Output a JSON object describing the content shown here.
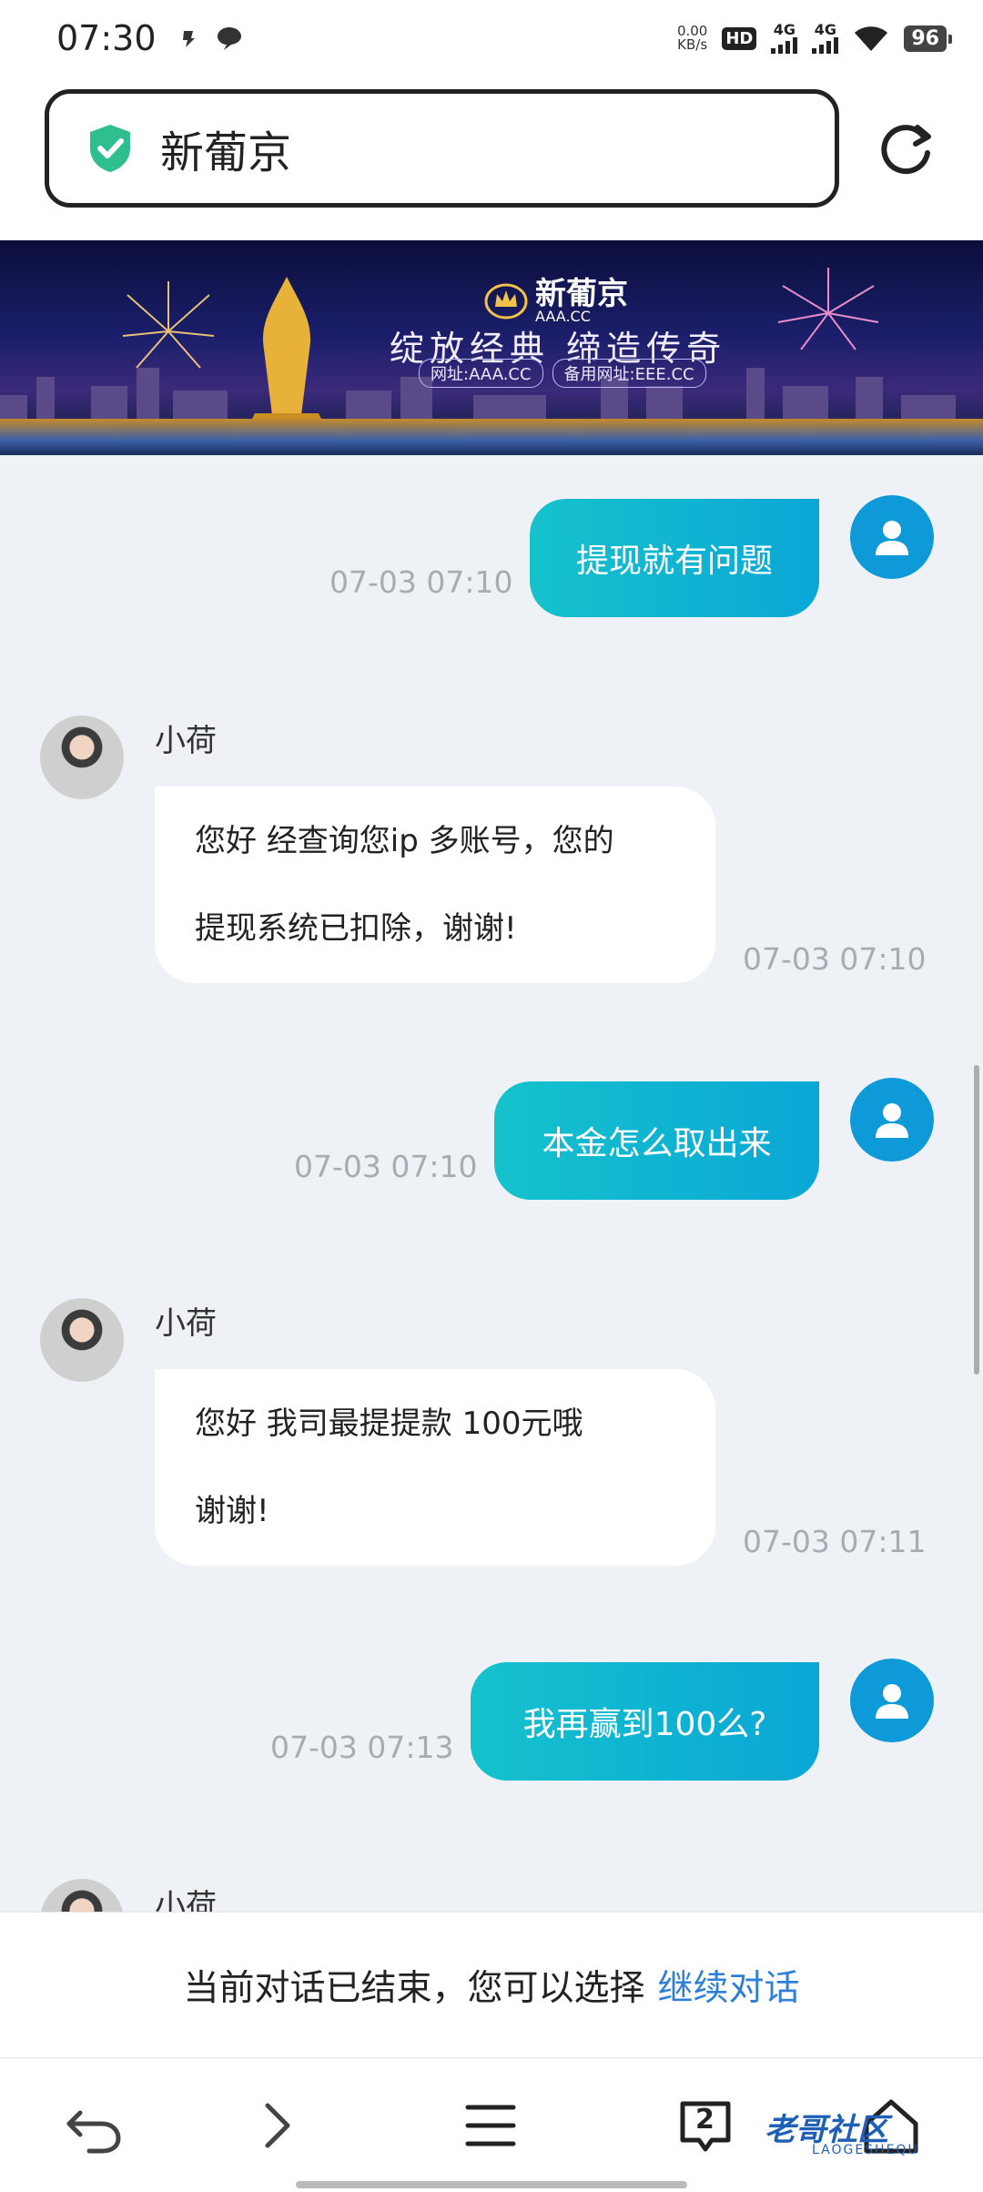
{
  "status_bar": {
    "time": "07:30",
    "net_speed_value": "0.00",
    "net_speed_unit": "KB/s",
    "hd_label": "HD",
    "sim1_label": "4G",
    "sim2_label": "4G",
    "battery": "96",
    "icons": [
      "notification-icon",
      "chat-bubble-icon",
      "wifi-icon"
    ]
  },
  "address_bar": {
    "title": "新葡京",
    "shield_color": "#2fbf8f"
  },
  "banner": {
    "brand": "新葡京",
    "brand_sub": "AAA.CC",
    "slogan": "绽放经典  缔造传奇",
    "url_main": "网址:AAA.CC",
    "url_backup": "备用网址:EEE.CC"
  },
  "messages": [
    {
      "side": "out",
      "text": "提现就有问题",
      "time": "07-03 07:10"
    },
    {
      "side": "in",
      "name": "小荷",
      "lines": [
        "您好 经查询您ip 多账号，您的",
        "提现系统已扣除，谢谢!"
      ],
      "time": "07-03 07:10"
    },
    {
      "side": "out",
      "text": "本金怎么取出来",
      "time": "07-03 07:10"
    },
    {
      "side": "in",
      "name": "小荷",
      "lines": [
        "您好  我司最提提款  100元哦",
        "谢谢!"
      ],
      "time": "07-03 07:11"
    },
    {
      "side": "out",
      "text": "我再赢到100么?",
      "time": "07-03 07:13"
    },
    {
      "side": "in",
      "name": "小荷"
    }
  ],
  "ended_bar": {
    "text": "当前对话已结束，您可以选择",
    "link": "继续对话",
    "link_color": "#2f7ed8"
  },
  "nav_bar": {
    "tab_count": "2",
    "watermark": "老哥社区",
    "watermark_sub": "LAOGESHEQU"
  },
  "colors": {
    "bubble_out_start": "#15c2cc",
    "bubble_out_end": "#0aa7d6",
    "user_avatar": "#0e9ad8",
    "timestamp": "#a7acb3",
    "background": "#eef2f6"
  }
}
